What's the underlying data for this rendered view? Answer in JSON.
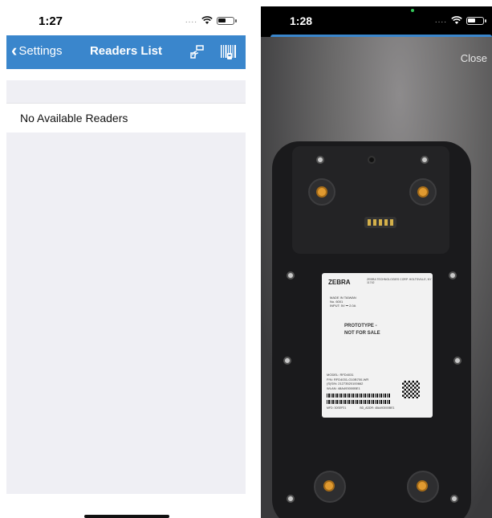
{
  "left_screen": {
    "status_bar": {
      "time": "1:27"
    },
    "nav": {
      "back_label": "Settings",
      "title": "Readers List"
    },
    "list": {
      "empty_message": "No Available Readers"
    }
  },
  "right_screen": {
    "status_bar": {
      "time": "1:28"
    },
    "close_label": "Close",
    "device_label": {
      "brand": "ZEBRA",
      "brand_sub": "ZEBRA TECHNOLOGIES CORP. HOLTSVILLE, NY 11742",
      "made_in": "MADE IN TAIWAN",
      "model_no": "No. 6001",
      "input": "INPUT: 5V ⎓ 2.0A",
      "prototype_line1": "PROTOTYPE -",
      "prototype_line2": "NOT FOR SALE",
      "model": "MODEL: RFD4031",
      "pn": "P/N: RFD4031-G10B700-WR",
      "sn": "(S)S/N: 21273520100662",
      "wlan": "WLAN: 48A493000BE1",
      "mfd": "MFD: 30SEP21",
      "bd_addr": "BD_ADDR: 48A493000BE1"
    }
  },
  "colors": {
    "nav_blue": "#3a86cc",
    "list_bg": "#efeff4"
  },
  "icons": [
    "back-chevron-icon",
    "rfid-reader-icon",
    "barcode-scanner-icon",
    "wifi-icon",
    "battery-icon"
  ]
}
